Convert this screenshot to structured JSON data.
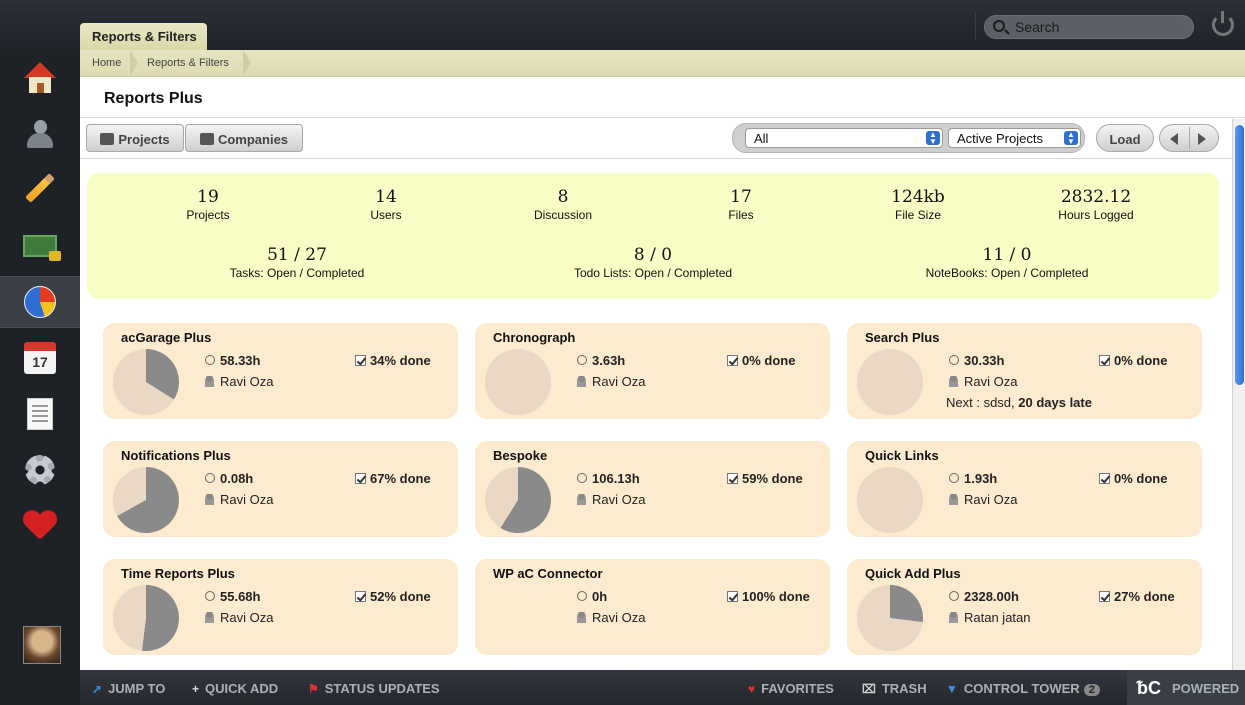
{
  "tab": {
    "label": "Reports & Filters"
  },
  "search": {
    "placeholder": "Search"
  },
  "breadcrumb": [
    "Home",
    "Reports & Filters"
  ],
  "page": {
    "title": "Reports Plus"
  },
  "toolbar": {
    "projects_label": "Projects",
    "companies_label": "Companies",
    "filter_all": "All",
    "filter_status": "Active Projects",
    "load_label": "Load"
  },
  "stats": {
    "row1": [
      {
        "value": "19",
        "label": "Projects"
      },
      {
        "value": "14",
        "label": "Users"
      },
      {
        "value": "8",
        "label": "Discussion"
      },
      {
        "value": "17",
        "label": "Files"
      },
      {
        "value": "124kb",
        "label": "File Size"
      },
      {
        "value": "2832.12",
        "label": "Hours Logged"
      }
    ],
    "row2": [
      {
        "value": "51 / 27",
        "label": "Tasks: Open / Completed"
      },
      {
        "value": "8 / 0",
        "label": "Todo Lists: Open / Completed"
      },
      {
        "value": "11 / 0",
        "label": "NoteBooks: Open / Completed"
      }
    ]
  },
  "projects": [
    {
      "name": "acGarage Plus",
      "hours": "58.33h",
      "user": "Ravi Oza",
      "done": "34% done",
      "progress": 0.34
    },
    {
      "name": "Chronograph",
      "hours": "3.63h",
      "user": "Ravi Oza",
      "done": "0% done",
      "progress": 0
    },
    {
      "name": "Search Plus",
      "hours": "30.33h",
      "user": "Ravi Oza",
      "done": "0% done",
      "progress": 0,
      "next_prefix": "Next : sdsd, ",
      "next_late": "20 days late"
    },
    {
      "name": "Notifications Plus",
      "hours": "0.08h",
      "user": "Ravi Oza",
      "done": "67% done",
      "progress": 0.67
    },
    {
      "name": "Bespoke",
      "hours": "106.13h",
      "user": "Ravi Oza",
      "done": "59% done",
      "progress": 0.59
    },
    {
      "name": "Quick Links",
      "hours": "1.93h",
      "user": "Ravi Oza",
      "done": "0% done",
      "progress": 0
    },
    {
      "name": "Time Reports Plus",
      "hours": "55.68h",
      "user": "Ravi Oza",
      "done": "52% done",
      "progress": 0.52
    },
    {
      "name": "WP aC Connector",
      "hours": "0h",
      "user": "Ravi Oza",
      "done": "100% done",
      "progress": 1.0,
      "hide_pie": true
    },
    {
      "name": "Quick Add Plus",
      "hours": "2328.00h",
      "user": "Ratan jatan",
      "done": "27% done",
      "progress": 0.27
    }
  ],
  "bottombar": {
    "jump_to": "JUMP TO",
    "quick_add": "QUICK ADD",
    "status_updates": "STATUS UPDATES",
    "favorites": "FAVORITES",
    "trash": "TRASH",
    "control_tower": "CONTROL TOWER",
    "control_tower_count": "2",
    "powered": "POWERED"
  },
  "colors": {
    "pie_done": "#8a8a8a",
    "pie_remaining": "#e9d8c3",
    "card_bg": "#fdebd0",
    "stats_bg": "#f8fcc5"
  }
}
